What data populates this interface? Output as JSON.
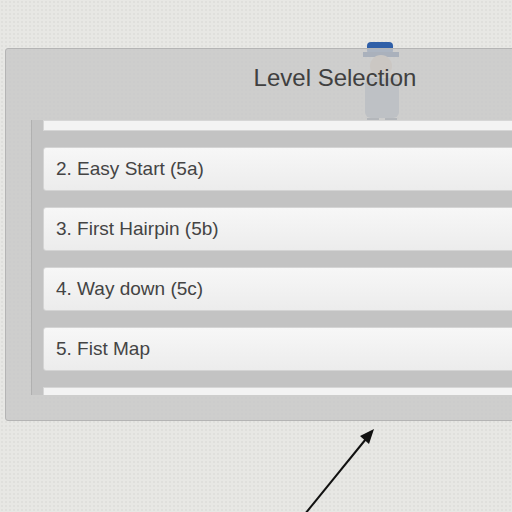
{
  "panel": {
    "title": "Level Selection"
  },
  "levels": [
    {
      "label": "2. Easy Start (5a)"
    },
    {
      "label": "3. First Hairpin (5b)"
    },
    {
      "label": "4. Way down (5c)"
    },
    {
      "label": "5. Fist Map"
    }
  ]
}
